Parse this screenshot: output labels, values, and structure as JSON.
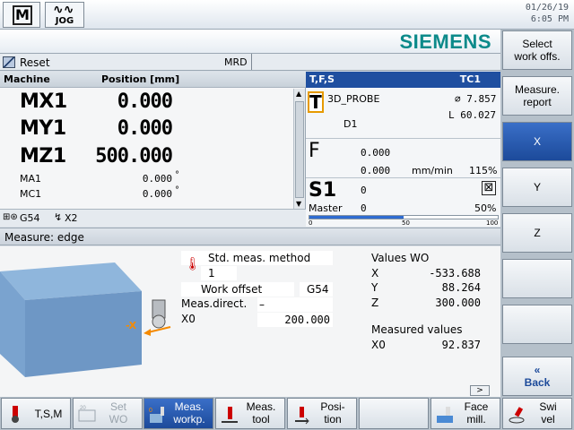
{
  "top": {
    "mode_m_glyph": "M",
    "mode_jog_label": "JOG",
    "date": "01/26/19",
    "time": "6:05 PM",
    "brand": "SIEMENS"
  },
  "status": {
    "reset_label": "Reset",
    "mrd_label": "MRD"
  },
  "machine": {
    "header_col1": "Machine",
    "header_col2": "Position [mm]",
    "rows_big": [
      {
        "axis": "MX1",
        "value": "0.000"
      },
      {
        "axis": "MY1",
        "value": "0.000"
      },
      {
        "axis": "MZ1",
        "value": "500.000"
      }
    ],
    "rows_small": [
      {
        "axis": "MA1",
        "value": "0.000",
        "unit": "°"
      },
      {
        "axis": "MC1",
        "value": "0.000",
        "unit": "°"
      }
    ],
    "info_g54": "G54",
    "info_x2": "X2"
  },
  "tfs": {
    "header_left": "T,F,S",
    "header_right": "TC1",
    "tool_letter": "T",
    "tool_name": "3D_PROBE",
    "tool_diameter": "⌀ 7.857",
    "tool_length": "L 60.027",
    "tool_d": "D1",
    "feed_letter": "F",
    "feed_value1": "0.000",
    "feed_value2": "0.000",
    "feed_unit": "mm/min",
    "feed_pct": "115%",
    "spindle_letter": "S1",
    "spindle_value": "0",
    "spindle_master": "Master",
    "spindle_master_value": "0",
    "spindle_pct": "50%",
    "spindle_level": 0.5,
    "tick_0": "0",
    "tick_50": "50",
    "tick_100": "100"
  },
  "measure": {
    "title": "Measure: edge",
    "std_method": "Std. meas. method",
    "std_method_value": "1",
    "work_offset_label": "Work offset",
    "work_offset_value": "G54",
    "meas_direct_label": "Meas.direct.",
    "meas_direct_value": "–",
    "x0_label": "X0",
    "x0_value": "200.000",
    "graphic_axis_label": "-X",
    "values_title": "Values WO",
    "values": [
      {
        "axis": "X",
        "value": "-533.688"
      },
      {
        "axis": "Y",
        "value": "88.264"
      },
      {
        "axis": "Z",
        "value": "300.000"
      }
    ],
    "measured_title": "Measured values",
    "measured_axis": "X0",
    "measured_value": "92.837",
    "scroll_right": ">"
  },
  "vkeys": [
    {
      "label": "Select\nwork offs.",
      "active": false
    },
    {
      "label": "Measure.\nreport",
      "active": false
    },
    {
      "label": "X",
      "active": true
    },
    {
      "label": "Y",
      "active": false
    },
    {
      "label": "Z",
      "active": false
    },
    {
      "label": "",
      "active": false
    },
    {
      "label": "",
      "active": false
    },
    {
      "label": "«\nBack",
      "active": false
    }
  ],
  "hkeys": [
    {
      "label": "T,S,M",
      "icon": "spindle-icon"
    },
    {
      "label": "Set\nWO",
      "icon": "set-wo-icon",
      "disabled": true
    },
    {
      "label": "Meas.\nworkp.",
      "icon": "measure-workpiece-icon",
      "active": true
    },
    {
      "label": "Meas.\ntool",
      "icon": "measure-tool-icon"
    },
    {
      "label": "Posi-\ntion",
      "icon": "position-icon"
    },
    {
      "label": "",
      "icon": ""
    },
    {
      "label": "Face\nmill.",
      "icon": "face-mill-icon"
    },
    {
      "label": "Swi\nvel",
      "icon": "swivel-icon"
    }
  ],
  "colors": {
    "accent_blue": "#1f4fa0",
    "brand_teal": "#0c8a8a",
    "tool_orange": "#e69a00"
  }
}
